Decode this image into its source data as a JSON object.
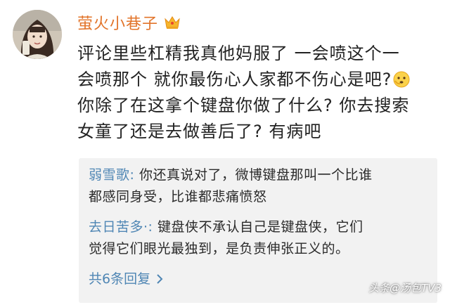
{
  "post": {
    "username": "萤火小巷子",
    "username_color": "#e2742a",
    "badge_icon": "crown-icon",
    "comment_lines": [
      "评论里些杠精我真他妈服了 一会喷这个一",
      "会喷那个 就你最伤心人家都不伤心是吧?",
      "你除了在这拿个键盘你做了什么? 你去搜索",
      "女童了还是去做善后了? 有病吧"
    ],
    "emoji_icon": "thinking-face-emoji-icon"
  },
  "replies": [
    {
      "author": "弱雪歌:",
      "lines": [
        "你还真说对了，微博键盘那叫一个比谁",
        "都感同身受，比谁都悲痛愤怒"
      ]
    },
    {
      "author": "去日苦多·:",
      "lines": [
        "键盘侠不承认自己是键盘侠，它们",
        "觉得它们眼光最独到，是负责伸张正义的。"
      ]
    }
  ],
  "more_replies_label": "共6条回复",
  "link_color": "#4f86b4",
  "watermark": "头条@汤包TV3"
}
